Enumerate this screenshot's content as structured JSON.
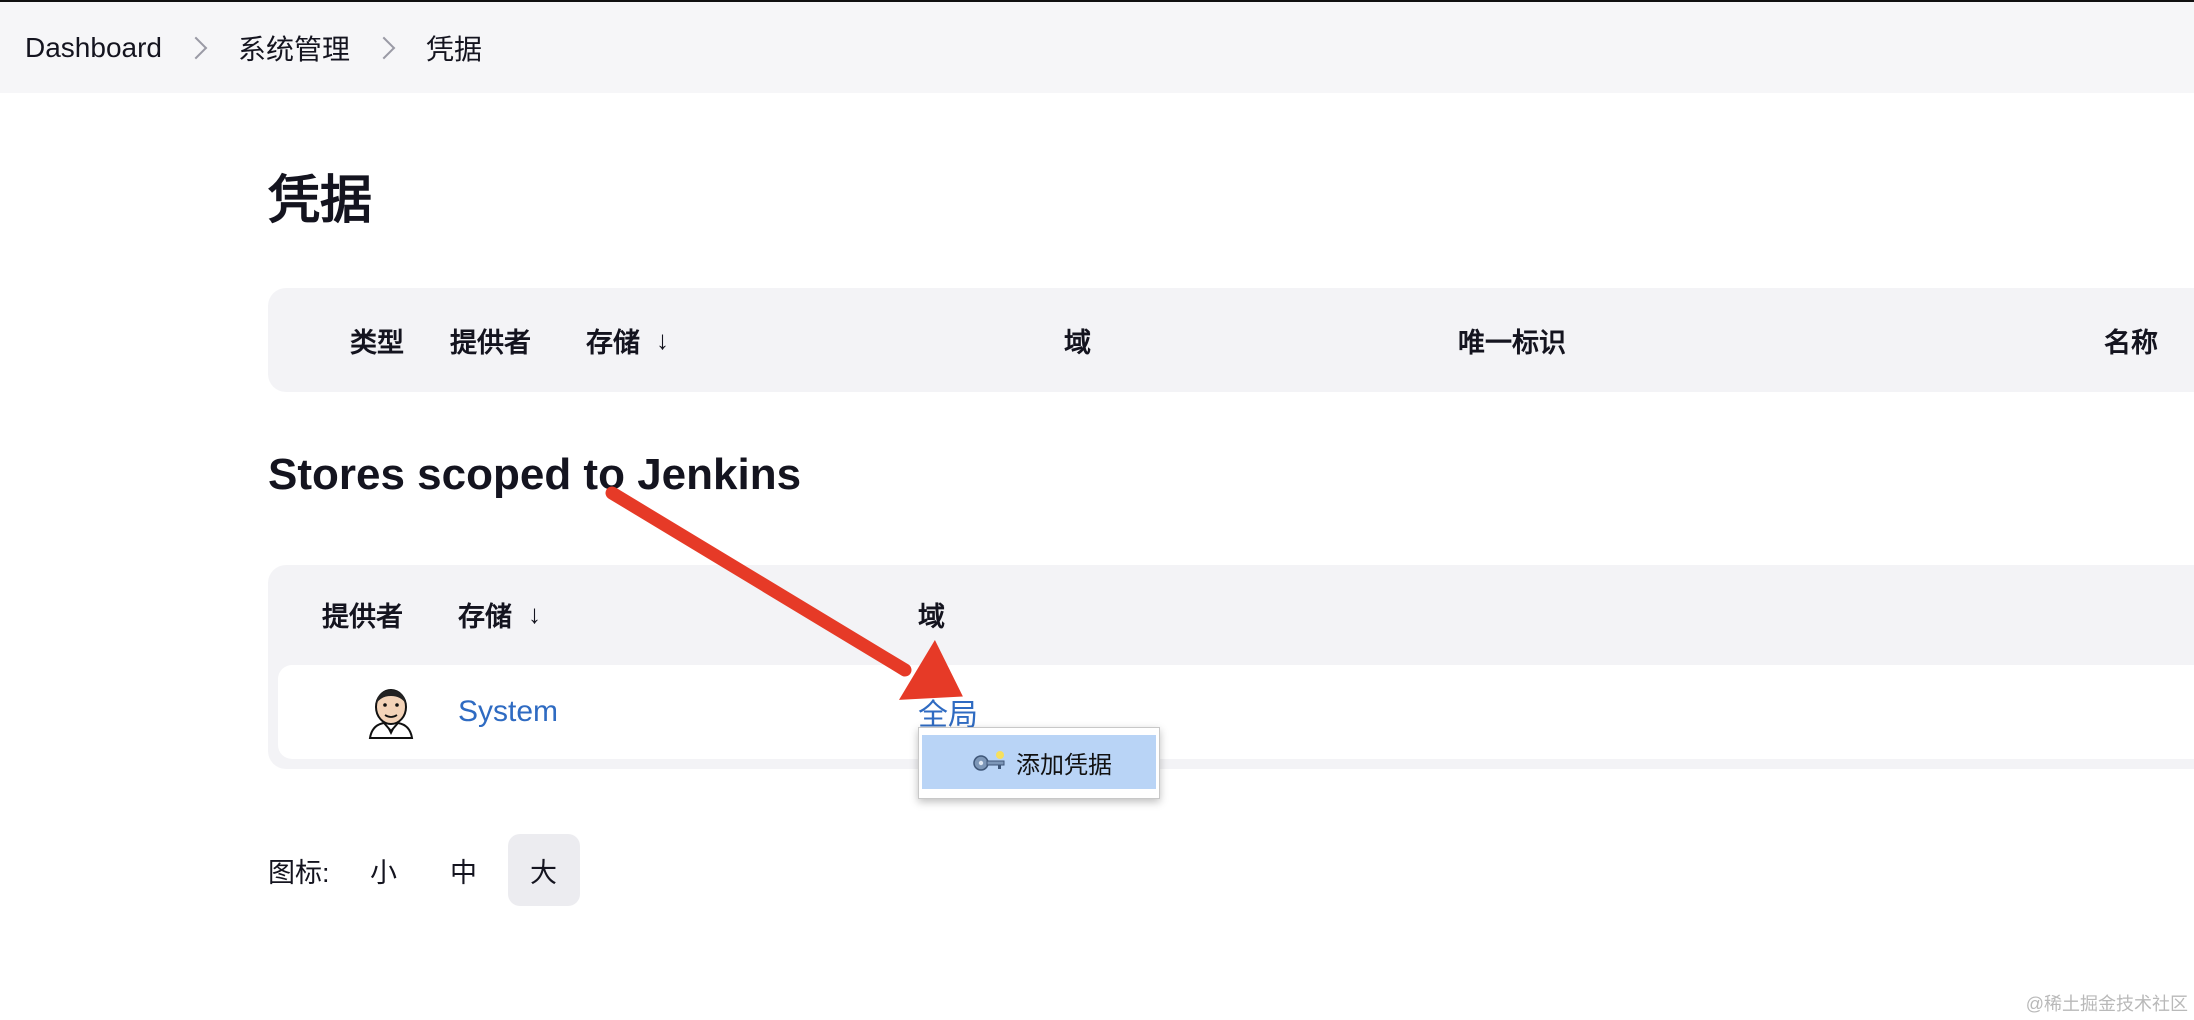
{
  "breadcrumb": {
    "items": [
      "Dashboard",
      "系统管理",
      "凭据"
    ]
  },
  "page_title": "凭据",
  "credentials_table": {
    "headers": {
      "type": "类型",
      "provider": "提供者",
      "store": "存储",
      "store_sort": "↓",
      "domain": "域",
      "id": "唯一标识",
      "name": "名称"
    }
  },
  "stores_section": {
    "title": "Stores scoped to Jenkins",
    "headers": {
      "provider": "提供者",
      "store": "存储",
      "store_sort": "↓",
      "domain": "域"
    },
    "rows": [
      {
        "provider_icon": "jenkins-butler-icon",
        "store": "System",
        "domain": "全局"
      }
    ]
  },
  "dropdown": {
    "item_icon": "key-icon",
    "item_label": "添加凭据"
  },
  "icon_size": {
    "label": "图标:",
    "options": [
      "小",
      "中",
      "大"
    ],
    "selected": "大"
  },
  "watermark": "@稀土掘金技术社区",
  "colors": {
    "link": "#2f6bc2",
    "annotation_arrow": "#e63a27",
    "dropdown_highlight": "#b9d4f6"
  }
}
